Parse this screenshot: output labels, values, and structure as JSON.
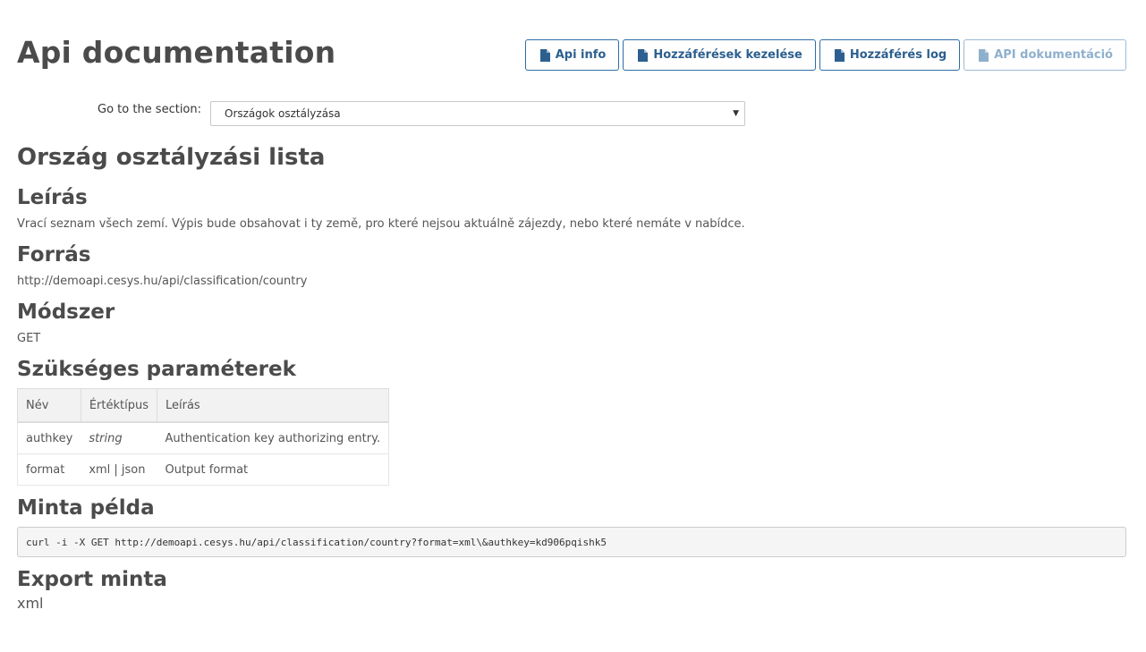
{
  "header": {
    "title": "Api documentation",
    "buttons": [
      {
        "label": "Api info",
        "icon": "document-icon",
        "disabled": false
      },
      {
        "label": "Hozzáférések kezelése",
        "icon": "document-icon",
        "disabled": false
      },
      {
        "label": "Hozzáférés log",
        "icon": "document-icon",
        "disabled": false
      },
      {
        "label": "API dokumentáció",
        "icon": "document-icon",
        "disabled": true
      }
    ]
  },
  "section_select": {
    "label": "Go to the section:",
    "selected": "Országok osztályzása"
  },
  "content": {
    "heading": "Ország osztályzási lista",
    "description": {
      "title": "Leírás",
      "text": "Vrací seznam všech zemí. Výpis bude obsahovat i ty země, pro které nejsou aktuálně zájezdy, nebo které nemáte v nabídce."
    },
    "resource": {
      "title": "Forrás",
      "text": "http://demoapi.cesys.hu/api/classification/country"
    },
    "method": {
      "title": "Módszer",
      "text": "GET"
    },
    "params": {
      "title": "Szükséges paraméterek",
      "columns": [
        "Név",
        "Értéktípus",
        "Leírás"
      ],
      "rows": [
        [
          "authkey",
          "string",
          "Authentication key authorizing entry."
        ],
        [
          "format",
          "xml | json",
          "Output format"
        ]
      ]
    },
    "example": {
      "title": "Minta példa",
      "code": "curl -i -X GET http://demoapi.cesys.hu/api/classification/country?format=xml\\&authkey=kd906pqishk5"
    },
    "export": {
      "title": "Export minta",
      "value": "xml"
    }
  },
  "colors": {
    "button_border": "#2e6da4",
    "button_text": "#2c5f8f",
    "button_disabled": "#8fb0cd",
    "heading": "#4b4b4b"
  }
}
